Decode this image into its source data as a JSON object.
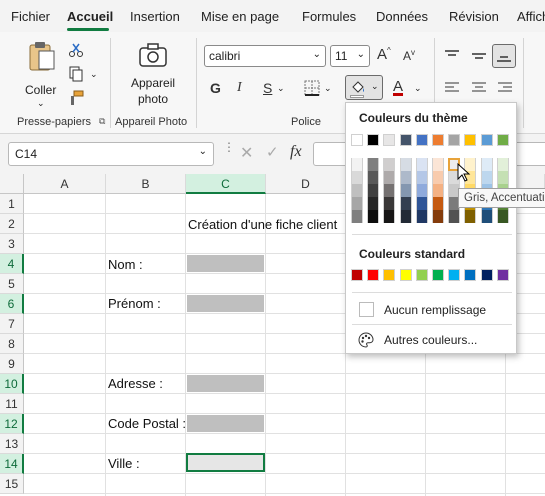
{
  "menu": {
    "tabs": [
      "Fichier",
      "Accueil",
      "Insertion",
      "Mise en page",
      "Formules",
      "Données",
      "Révision",
      "Affich"
    ]
  },
  "ribbon": {
    "clipboard": {
      "paste_label": "Coller",
      "group_label": "Presse-papiers"
    },
    "photo": {
      "label_line1": "Appareil",
      "label_line2": "photo",
      "group_label": "Appareil Photo"
    },
    "font": {
      "font_name": "calibri",
      "font_size": "11",
      "bold": "G",
      "italic": "I",
      "underline": "S",
      "group_label": "Police",
      "font_color_letter": "A",
      "grow_label": "A",
      "shrink_label": "A"
    }
  },
  "formula_bar": {
    "name_box": "C14",
    "fx": "fx"
  },
  "grid": {
    "columns": [
      "A",
      "B",
      "C",
      "D"
    ],
    "rows": [
      "1",
      "2",
      "3",
      "4",
      "5",
      "6",
      "7",
      "8",
      "9",
      "10",
      "11",
      "12",
      "13",
      "14",
      "15"
    ],
    "cells": {
      "title": "Création d'une fiche client",
      "nom": "Nom :",
      "prenom": "Prénom :",
      "adresse": "Adresse :",
      "code_postal": "Code Postal :",
      "ville": "Ville :"
    }
  },
  "dropdown": {
    "theme_title": "Couleurs du thème",
    "standard_title": "Couleurs standard",
    "no_fill": "Aucun remplissage",
    "more_colors": "Autres couleurs...",
    "theme_colors": [
      "#ffffff",
      "#000000",
      "#e7e6e6",
      "#44546a",
      "#4472c4",
      "#ed7d31",
      "#a5a5a5",
      "#ffc000",
      "#5b9bd5",
      "#70ad47"
    ],
    "theme_shades": [
      [
        "#f2f2f2",
        "#7f7f7f",
        "#d0cece",
        "#d6dce4",
        "#dae3f3",
        "#fbe5d6",
        "#ededed",
        "#fff2cc",
        "#deebf7",
        "#e2f0d9"
      ],
      [
        "#d9d9d9",
        "#595959",
        "#aeaaaa",
        "#adb9ca",
        "#b4c7e7",
        "#f8cbad",
        "#dbdbdb",
        "#ffe699",
        "#bdd7ee",
        "#c5e0b4"
      ],
      [
        "#bfbfbf",
        "#404040",
        "#757171",
        "#8497b0",
        "#8faadc",
        "#f4b183",
        "#c9c9c9",
        "#ffd966",
        "#9dc3e6",
        "#a9d18e"
      ],
      [
        "#a6a6a6",
        "#262626",
        "#3a3838",
        "#333f50",
        "#2f5597",
        "#c55a11",
        "#7b7b7b",
        "#bf9000",
        "#2e75b6",
        "#548235"
      ],
      [
        "#7f7f7f",
        "#0d0d0d",
        "#171616",
        "#222a35",
        "#203864",
        "#843c0c",
        "#525252",
        "#7f6000",
        "#1f4e79",
        "#385723"
      ]
    ],
    "standard_colors": [
      "#c00000",
      "#ff0000",
      "#ffc000",
      "#ffff00",
      "#92d050",
      "#00b050",
      "#00b0f0",
      "#0070c0",
      "#002060",
      "#7030a0"
    ]
  },
  "tooltip": "Gris, Accentuation 3, plus clair 80%",
  "colors": {
    "accent": "#117c41",
    "input_fill": "#bfbfbf"
  }
}
